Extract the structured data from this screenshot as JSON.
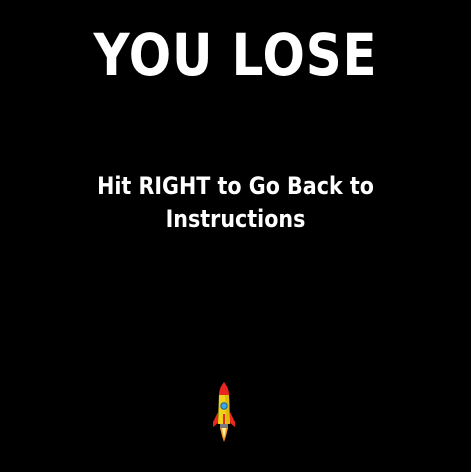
{
  "screen": {
    "title": "YOU LOSE",
    "instructions": "Hit RIGHT to Go Back to Instructions"
  },
  "player": {
    "icon": "rocket-icon"
  },
  "colors": {
    "background": "#000000",
    "text": "#ffffff",
    "rocket_body": "#f2d11a",
    "rocket_accent": "#e8281e",
    "rocket_window": "#3aa7e8"
  }
}
